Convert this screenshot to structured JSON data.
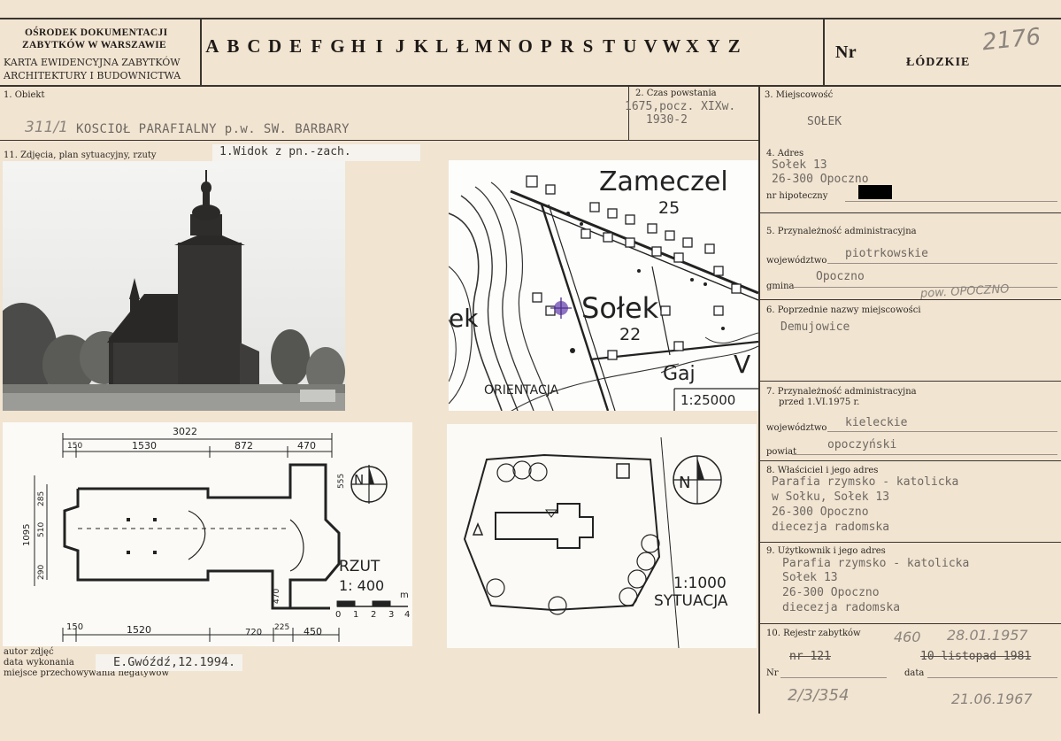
{
  "header": {
    "office_line1": "OŚRODEK DOKUMENTACJI",
    "office_line2": "ZABYTKÓW W WARSZAWIE",
    "card_type_line1": "KARTA EWIDENCYJNA ZABYTKÓW",
    "card_type_line2": "ARCHITEKTURY I BUDOWNICTWA",
    "letters": [
      "A",
      "B",
      "C",
      "D",
      "E",
      "F",
      "G",
      "H",
      "I",
      "J",
      "K",
      "L",
      "Ł",
      "M",
      "N",
      "O",
      "P",
      "R",
      "S",
      "T",
      "U",
      "V",
      "W",
      "X",
      "Y",
      "Z"
    ],
    "nr_label": "Nr",
    "region": "ŁÓDZKIE",
    "card_number": "2176"
  },
  "obiekt": {
    "label": "1. Obiekt",
    "ref": "311/1",
    "name": "KOSCIOŁ PARAFIALNY p.w. SW. BARBARY"
  },
  "czas": {
    "label": "2. Czas powstania",
    "line1": "1675,pocz. XIXw.",
    "line2": "1930-2"
  },
  "miejscowosc": {
    "label": "3. Miejscowość",
    "value": "SOŁEK"
  },
  "zdjecia": {
    "label": "11. Zdjęcia, plan sytuacyjny, rzuty",
    "caption": "1.Widok z pn.-zach."
  },
  "map": {
    "place1": "Zameczel",
    "num1": "25",
    "place2": "Sołek",
    "num2": "22",
    "place3": "Gaj",
    "left_frag": "ek",
    "right_frag": "V",
    "orientation": "ORIENTACJA",
    "scale": "1:25000"
  },
  "plan": {
    "dims_top": [
      "3022",
      "150",
      "1530",
      "872",
      "470"
    ],
    "dims_bottom": [
      "150",
      "1520",
      "720",
      "225",
      "450"
    ],
    "dims_left": [
      "1095",
      "510",
      "285",
      "290"
    ],
    "dims_right": [
      "555",
      "470"
    ],
    "north": "N",
    "title": "RZUT",
    "scale": "1: 400",
    "scale_ticks": [
      "0",
      "1",
      "2",
      "3",
      "4"
    ],
    "unit": "m"
  },
  "situation": {
    "north": "N",
    "scale": "1:1000",
    "title": "SYTUACJA"
  },
  "adres": {
    "label": "4. Adres",
    "line1": "Sołek 13",
    "line2": "26-300 Opoczno",
    "hipoteczny_label": "nr hipoteczny"
  },
  "przynaleznosc": {
    "label": "5. Przynależność administracyjna",
    "woj_label": "województwo",
    "woj_value": "piotrkowskie",
    "gmina_label": "gmina",
    "gmina_value": "Opoczno",
    "pow_note": "pow. OPOCZNO"
  },
  "poprzednie": {
    "label": "6. Poprzednie nazwy miejscowości",
    "value": "Demujowice"
  },
  "przed1975": {
    "label_line1": "7. Przynależność administracyjna",
    "label_line2": "przed 1.VI.1975 r.",
    "woj_label": "województwo",
    "woj_value": "kieleckie",
    "powiat_label": "powiat",
    "powiat_value": "opoczyński"
  },
  "wlasciciel": {
    "label": "8. Właściciel i jego adres",
    "lines": [
      "Parafia rzymsko - katolicka",
      "w Sołku, Sołek 13",
      "26-300 Opoczno",
      "diecezja radomska"
    ]
  },
  "uzytkownik": {
    "label": "9. Użytkownik i jego adres",
    "lines": [
      "Parafia rzymsko - katolicka",
      "Sołek 13",
      "26-300 Opoczno",
      "diecezja radomska"
    ]
  },
  "rejestr": {
    "label": "10. Rejestr zabytków",
    "hand1": "460",
    "hand1_date": "28.01.1957",
    "nr_old": "nr 121",
    "date_old": "10 listopad 1981",
    "nr_label": "Nr",
    "data_label": "data",
    "hand2": "2/3/354",
    "hand2_date": "21.06.1967"
  },
  "autor": {
    "label_line1": "autor zdjęć",
    "label_line2": "data wykonania",
    "label_line3": "miejsce przechowywania negatywów",
    "value": "E.Gwóźdź,12.1994."
  }
}
